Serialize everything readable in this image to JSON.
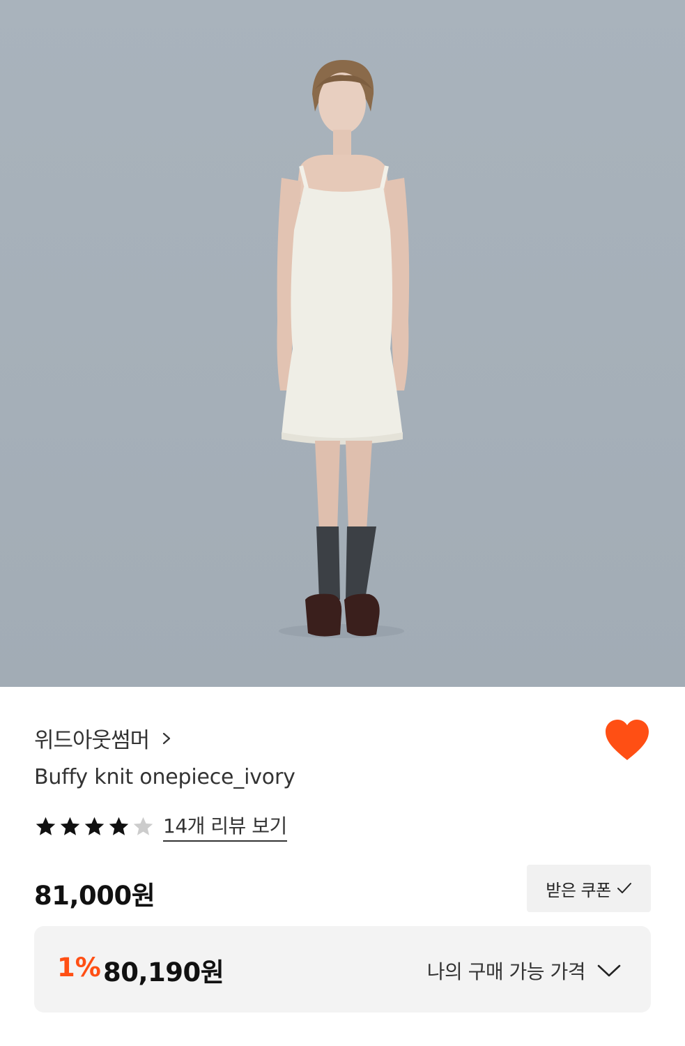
{
  "product": {
    "brand": "위드아웃썸머",
    "title": "Buffy knit onepiece_ivory",
    "rating_value": 4,
    "rating_max": 5,
    "review_link": "14개 리뷰 보기",
    "price": "81,000원",
    "coupon_label": "받은 쿠폰",
    "discount_rate": "1%",
    "final_price": "80,190원",
    "my_price_label": "나의 구매 가능 가격"
  },
  "colors": {
    "accent": "#ff4f14",
    "heart": "#ff4f14",
    "star_filled": "#111111",
    "star_empty": "#cccccc"
  },
  "icons": {
    "brand_arrow": "chevron-right-icon",
    "wishlist": "heart-icon",
    "coupon": "check-icon",
    "my_price": "chevron-down-icon",
    "rating": "star-icon"
  }
}
